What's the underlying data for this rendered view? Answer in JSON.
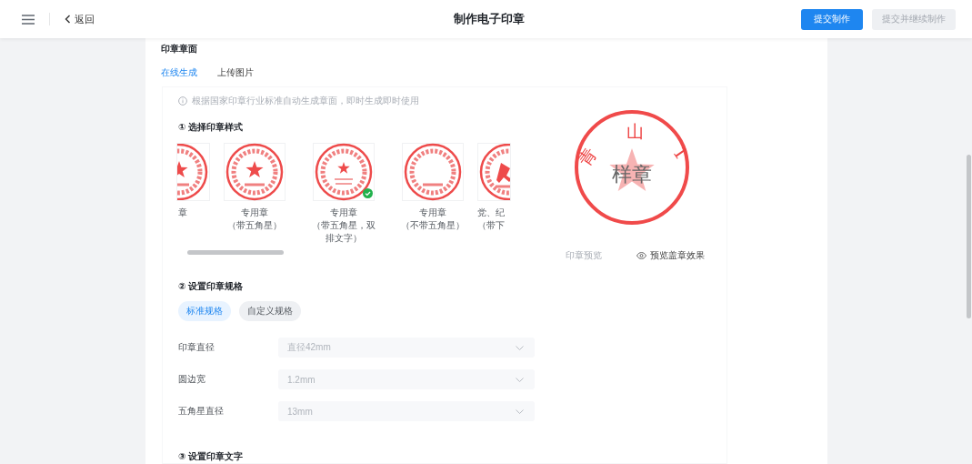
{
  "header": {
    "back": "返回",
    "title": "制作电子印章",
    "buttons": [
      {
        "label": "提交制作",
        "kind": "primary",
        "disabled": false
      },
      {
        "label": "提交并继续制作",
        "kind": "secondary",
        "disabled": true
      }
    ]
  },
  "section_title": "印章章面",
  "tabs": [
    {
      "label": "在线生成",
      "selected": true
    },
    {
      "label": "上传图片",
      "selected": false
    }
  ],
  "info": "根据国家印章行业标准自动生成章面，即时生成即时使用",
  "style_picker": {
    "heading": "① 选择印章样式",
    "styles": [
      {
        "kind": "star",
        "lines": [
          "章"
        ],
        "selected": false
      },
      {
        "kind": "star",
        "lines": [
          "专用章",
          "（带五角星）"
        ],
        "selected": false
      },
      {
        "kind": "star-double",
        "lines": [
          "专用章",
          "（带五角星，双",
          "排文字）"
        ],
        "selected": true
      },
      {
        "kind": "no-star",
        "lines": [
          "专用章",
          "（不带五角星）"
        ],
        "selected": false
      },
      {
        "kind": "emblem",
        "lines": [
          "党、纪",
          "（带下"
        ],
        "selected": false
      }
    ]
  },
  "preview": {
    "arc_text": [
      "青",
      "山",
      "1"
    ],
    "center_text": "样章",
    "label": "印章预览",
    "action": "预览盖章效果"
  },
  "spec": {
    "heading": "② 设置印章规格",
    "modes": [
      {
        "label": "标准规格",
        "selected": true
      },
      {
        "label": "自定义规格",
        "selected": false
      }
    ],
    "fields": [
      {
        "label": "印章直径",
        "value": "直径42mm"
      },
      {
        "label": "圆边宽",
        "value": "1.2mm"
      },
      {
        "label": "五角星直径",
        "value": "13mm"
      }
    ]
  },
  "text_section": {
    "heading": "③ 设置印章文字"
  }
}
